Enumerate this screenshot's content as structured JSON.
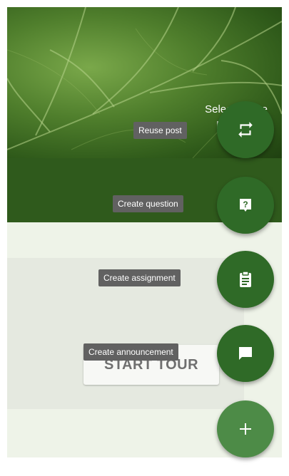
{
  "hero": {
    "text_line1": "Selec",
    "text_line1_tail": "e",
    "text_line2": "pl"
  },
  "tour_button": {
    "label": "START TOUR"
  },
  "speed_dial": {
    "actions": [
      {
        "label": "Reuse post",
        "icon": "repeat-icon"
      },
      {
        "label": "Create question",
        "icon": "question-icon"
      },
      {
        "label": "Create assignment",
        "icon": "clipboard-icon"
      },
      {
        "label": "Create announcement",
        "icon": "chat-icon"
      }
    ],
    "main_icon": "plus-icon"
  },
  "colors": {
    "fab": "#2f6a27",
    "fab_main": "#4d8b47",
    "band": "#2f5a1c",
    "tooltip": "#616161"
  }
}
